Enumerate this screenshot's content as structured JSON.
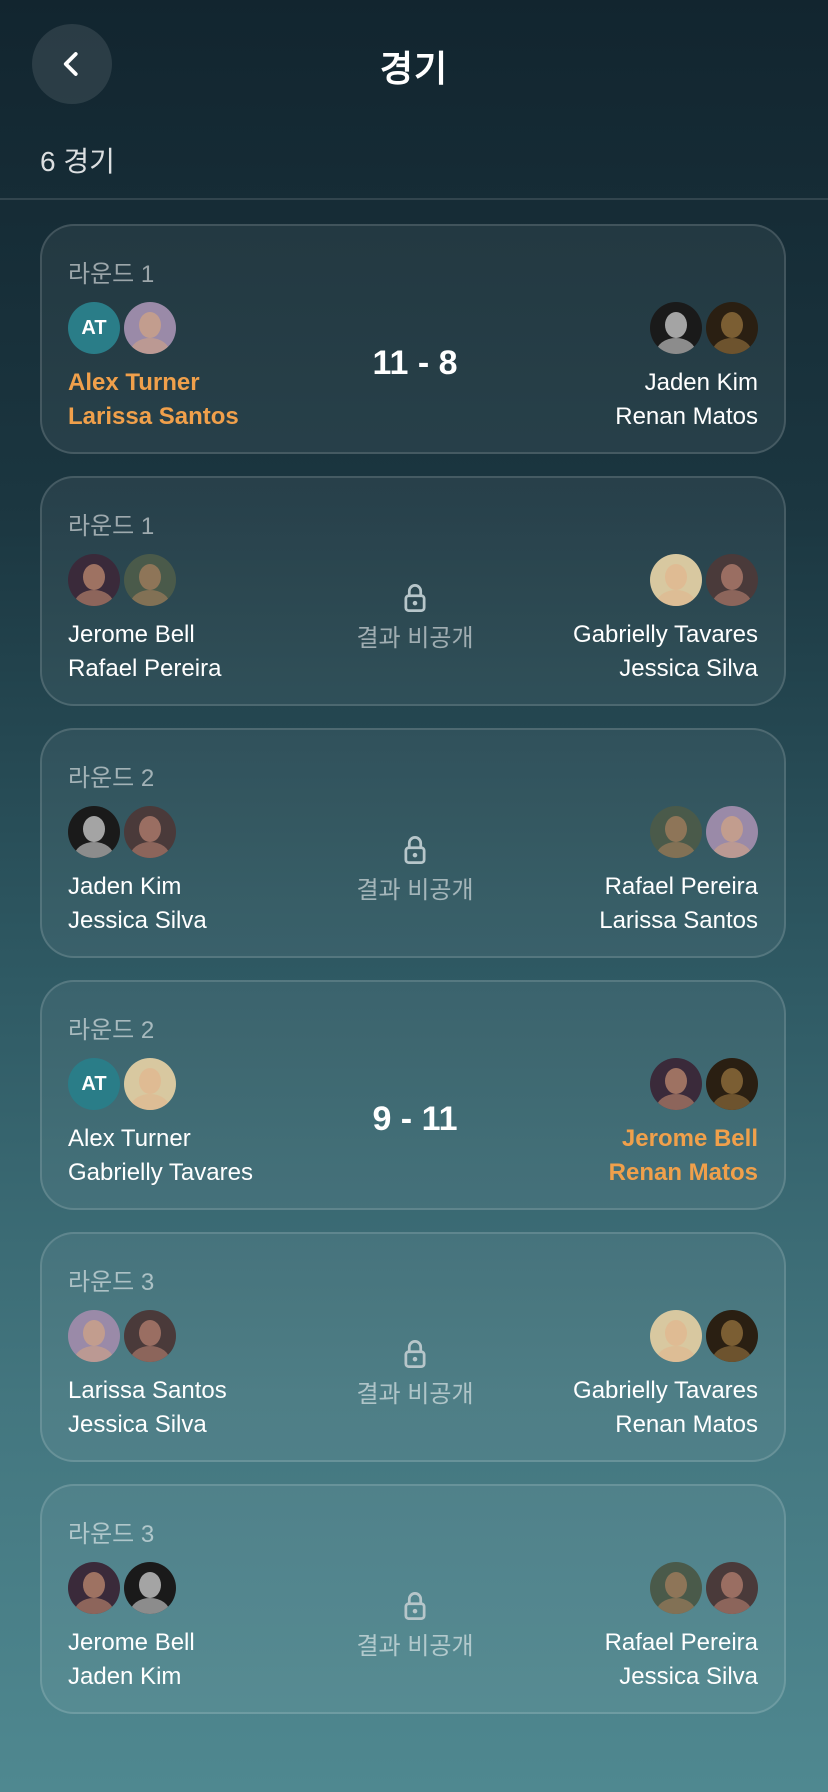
{
  "header": {
    "title": "경기",
    "back_label": "back"
  },
  "summary": {
    "count_text": "6 경기"
  },
  "colors": {
    "winner": "#f0a04b",
    "initials_bg": "#2a7d88"
  },
  "matches": [
    {
      "round": "라운드 1",
      "left": {
        "names": [
          "Alex Turner",
          "Larissa Santos"
        ],
        "winner": true,
        "avatars": [
          {
            "type": "initials",
            "text": "AT"
          },
          {
            "type": "photo",
            "name": "female-portrait-icon",
            "skin": "#c9a08a",
            "bg": "#9a8aa8"
          }
        ]
      },
      "right": {
        "names": [
          "Jaden Kim",
          "Renan Matos"
        ],
        "winner": false,
        "avatars": [
          {
            "type": "photo",
            "name": "male-portrait-icon",
            "skin": "#bdbdbd",
            "bg": "#1a1a1a"
          },
          {
            "type": "photo",
            "name": "male-portrait-icon",
            "skin": "#8a6a3a",
            "bg": "#2a1f12"
          }
        ]
      },
      "result": {
        "type": "score",
        "text": "11 - 8"
      }
    },
    {
      "round": "라운드 1",
      "left": {
        "names": [
          "Jerome Bell",
          "Rafael Pereira"
        ],
        "winner": false,
        "avatars": [
          {
            "type": "photo",
            "name": "male-portrait-icon",
            "skin": "#b07f6a",
            "bg": "#3a2a3a"
          },
          {
            "type": "photo",
            "name": "male-portrait-icon",
            "skin": "#9a7a5a",
            "bg": "#4a5a4a"
          }
        ]
      },
      "right": {
        "names": [
          "Gabrielly Tavares",
          "Jessica Silva"
        ],
        "winner": false,
        "avatars": [
          {
            "type": "photo",
            "name": "female-portrait-icon",
            "skin": "#e0b890",
            "bg": "#d8c8a0"
          },
          {
            "type": "photo",
            "name": "female-portrait-icon",
            "skin": "#a8786a",
            "bg": "#4a3a3a"
          }
        ]
      },
      "result": {
        "type": "private",
        "text": "결과 비공개"
      }
    },
    {
      "round": "라운드 2",
      "left": {
        "names": [
          "Jaden Kim",
          "Jessica Silva"
        ],
        "winner": false,
        "avatars": [
          {
            "type": "photo",
            "name": "male-portrait-icon",
            "skin": "#bdbdbd",
            "bg": "#1a1a1a"
          },
          {
            "type": "photo",
            "name": "female-portrait-icon",
            "skin": "#a8786a",
            "bg": "#4a3a3a"
          }
        ]
      },
      "right": {
        "names": [
          "Rafael Pereira",
          "Larissa Santos"
        ],
        "winner": false,
        "avatars": [
          {
            "type": "photo",
            "name": "male-portrait-icon",
            "skin": "#9a7a5a",
            "bg": "#4a5a4a"
          },
          {
            "type": "photo",
            "name": "female-portrait-icon",
            "skin": "#c9a08a",
            "bg": "#9a8aa8"
          }
        ]
      },
      "result": {
        "type": "private",
        "text": "결과 비공개"
      }
    },
    {
      "round": "라운드 2",
      "left": {
        "names": [
          "Alex Turner",
          "Gabrielly Tavares"
        ],
        "winner": false,
        "avatars": [
          {
            "type": "initials",
            "text": "AT"
          },
          {
            "type": "photo",
            "name": "female-portrait-icon",
            "skin": "#e0b890",
            "bg": "#d8c8a0"
          }
        ]
      },
      "right": {
        "names": [
          "Jerome Bell",
          "Renan Matos"
        ],
        "winner": true,
        "avatars": [
          {
            "type": "photo",
            "name": "male-portrait-icon",
            "skin": "#b07f6a",
            "bg": "#3a2a3a"
          },
          {
            "type": "photo",
            "name": "male-portrait-icon",
            "skin": "#8a6a3a",
            "bg": "#2a1f12"
          }
        ]
      },
      "result": {
        "type": "score",
        "text": "9 - 11"
      }
    },
    {
      "round": "라운드 3",
      "left": {
        "names": [
          "Larissa Santos",
          "Jessica Silva"
        ],
        "winner": false,
        "avatars": [
          {
            "type": "photo",
            "name": "female-portrait-icon",
            "skin": "#c9a08a",
            "bg": "#9a8aa8"
          },
          {
            "type": "photo",
            "name": "female-portrait-icon",
            "skin": "#a8786a",
            "bg": "#4a3a3a"
          }
        ]
      },
      "right": {
        "names": [
          "Gabrielly Tavares",
          "Renan Matos"
        ],
        "winner": false,
        "avatars": [
          {
            "type": "photo",
            "name": "female-portrait-icon",
            "skin": "#e0b890",
            "bg": "#d8c8a0"
          },
          {
            "type": "photo",
            "name": "male-portrait-icon",
            "skin": "#8a6a3a",
            "bg": "#2a1f12"
          }
        ]
      },
      "result": {
        "type": "private",
        "text": "결과 비공개"
      }
    },
    {
      "round": "라운드 3",
      "left": {
        "names": [
          "Jerome Bell",
          "Jaden Kim"
        ],
        "winner": false,
        "avatars": [
          {
            "type": "photo",
            "name": "male-portrait-icon",
            "skin": "#b07f6a",
            "bg": "#3a2a3a"
          },
          {
            "type": "photo",
            "name": "male-portrait-icon",
            "skin": "#bdbdbd",
            "bg": "#1a1a1a"
          }
        ]
      },
      "right": {
        "names": [
          "Rafael Pereira",
          "Jessica Silva"
        ],
        "winner": false,
        "avatars": [
          {
            "type": "photo",
            "name": "male-portrait-icon",
            "skin": "#9a7a5a",
            "bg": "#4a5a4a"
          },
          {
            "type": "photo",
            "name": "female-portrait-icon",
            "skin": "#a8786a",
            "bg": "#4a3a3a"
          }
        ]
      },
      "result": {
        "type": "private",
        "text": "결과 비공개"
      }
    }
  ]
}
